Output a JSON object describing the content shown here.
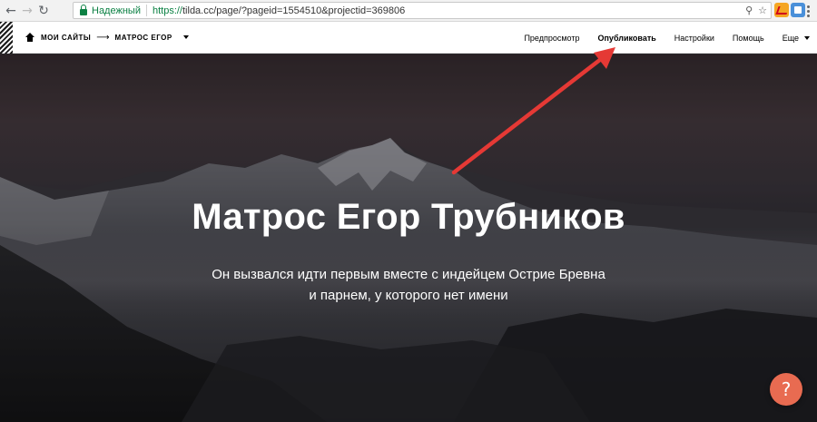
{
  "browser": {
    "security_label": "Надежный",
    "url_protocol": "https://",
    "url_rest": "tilda.cc/page/?pageid=1554510&projectid=369806",
    "icons": [
      "back-icon",
      "forward-icon",
      "reload-icon",
      "lock-icon",
      "zoom-icon",
      "star-icon"
    ]
  },
  "topbar": {
    "breadcrumb_site": "МОИ САЙТЫ",
    "breadcrumb_arrow": "⟶",
    "breadcrumb_page": "МАТРОС ЕГОР",
    "nav": {
      "preview": "Предпросмотр",
      "publish": "Опубликовать",
      "settings": "Настройки",
      "help": "Помощь",
      "more": "Еще"
    }
  },
  "hero": {
    "title": "Матрос Егор Трубников",
    "subtitle_line1": "Он вызвался идти первым вместе с индейцем Острие Бревна",
    "subtitle_line2": "и парнем, у которого нет имени"
  },
  "help_button": {
    "label": "?"
  },
  "colors": {
    "accent_arrow": "#e53935",
    "help_button": "#e86b51",
    "secure_green": "#0b8043"
  }
}
